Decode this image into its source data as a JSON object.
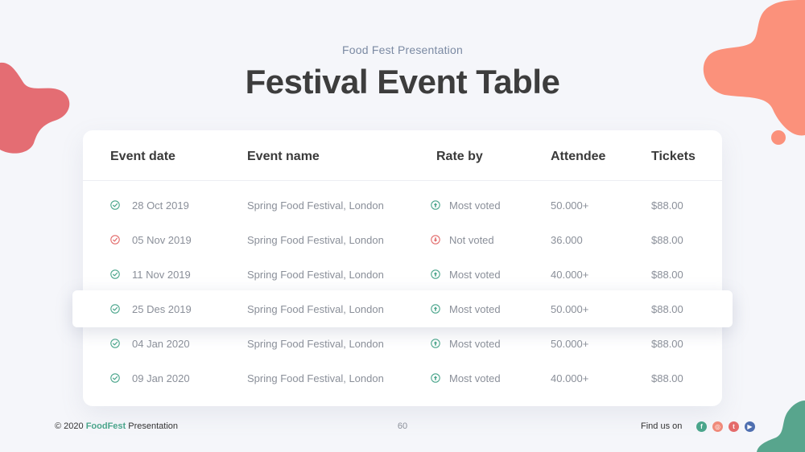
{
  "header": {
    "subtitle": "Food Fest Presentation",
    "title": "Festival Event Table"
  },
  "table": {
    "columns": [
      "Event date",
      "Event name",
      "Rate by",
      "Attendee",
      "Tickets"
    ],
    "rows": [
      {
        "date": "28 Oct 2019",
        "name": "Spring Food Festival, London",
        "rate": "Most voted",
        "attendee": "50.000+",
        "tickets": "$88.00",
        "status": "ok"
      },
      {
        "date": "05 Nov 2019",
        "name": "Spring Food Festival, London",
        "rate": "Not voted",
        "attendee": "36.000",
        "tickets": "$88.00",
        "status": "bad"
      },
      {
        "date": "11 Nov 2019",
        "name": "Spring Food Festival, London",
        "rate": "Most voted",
        "attendee": "40.000+",
        "tickets": "$88.00",
        "status": "ok"
      },
      {
        "date": "25 Des 2019",
        "name": "Spring Food Festival, London",
        "rate": "Most voted",
        "attendee": "50.000+",
        "tickets": "$88.00",
        "status": "ok"
      },
      {
        "date": "04 Jan 2020",
        "name": "Spring Food Festival, London",
        "rate": "Most voted",
        "attendee": "50.000+",
        "tickets": "$88.00",
        "status": "ok"
      },
      {
        "date": "09 Jan 2020",
        "name": "Spring Food Festival, London",
        "rate": "Most voted",
        "attendee": "40.000+",
        "tickets": "$88.00",
        "status": "ok"
      }
    ],
    "highlighted_row": 3
  },
  "footer": {
    "copyright": "© 2020",
    "brand": "FoodFest",
    "suffix": "Presentation",
    "page_number": "60",
    "find_us": "Find  us on",
    "social": [
      {
        "icon": "facebook-icon",
        "glyph": "f",
        "color": "#4aa58b"
      },
      {
        "icon": "instagram-icon",
        "glyph": "◎",
        "color": "#f08a7a"
      },
      {
        "icon": "twitter-icon",
        "glyph": "t",
        "color": "#e46b6b"
      },
      {
        "icon": "youtube-icon",
        "glyph": "▶",
        "color": "#4f6fb0"
      }
    ]
  },
  "colors": {
    "ok": "#4aa58b",
    "bad": "#e26a6a",
    "blob_left": "#e46d73",
    "blob_right": "#fb917b",
    "blob_bottom": "#58a58d"
  }
}
